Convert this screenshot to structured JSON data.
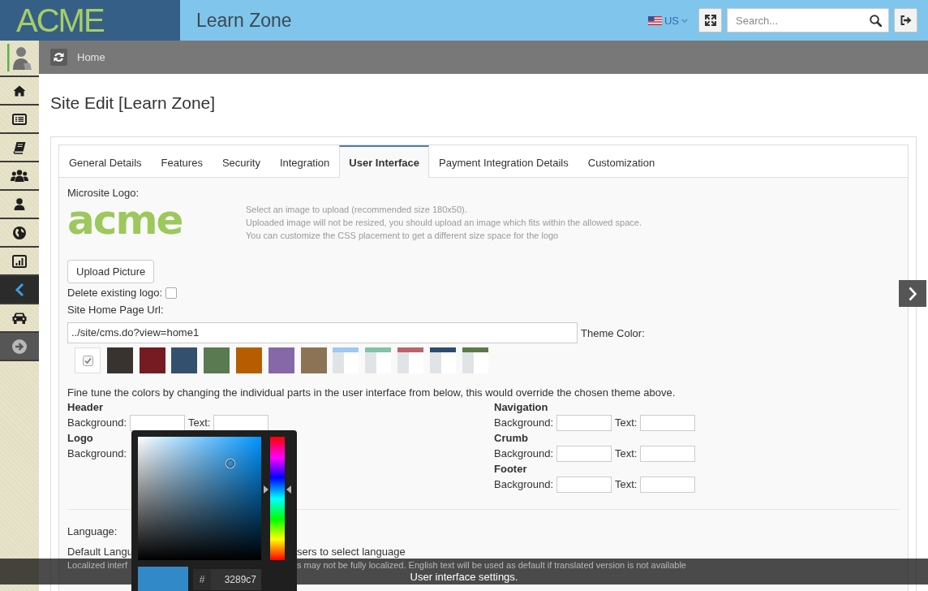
{
  "topbar": {
    "brand": "ACME",
    "site_name": "Learn Zone",
    "language": "US",
    "search": {
      "placeholder": "Search..."
    }
  },
  "sidebar": {
    "items": [
      {
        "kind": "link",
        "selected": false
      },
      {
        "kind": "link",
        "selected": false
      },
      {
        "kind": "link",
        "selected": false
      },
      {
        "kind": "link",
        "selected": false
      },
      {
        "kind": "link",
        "selected": false
      },
      {
        "kind": "link",
        "selected": false
      },
      {
        "kind": "link",
        "selected": false
      },
      {
        "kind": "link",
        "selected": true
      },
      {
        "kind": "link",
        "selected": false
      },
      {
        "kind": "toggle",
        "selected": false
      }
    ]
  },
  "breadcrumb": {
    "items": [
      "Home"
    ]
  },
  "page_title": "Site Edit [Learn Zone]",
  "tabs": [
    {
      "label": "General Details",
      "selected": false
    },
    {
      "label": "Features",
      "selected": false
    },
    {
      "label": "Security",
      "selected": false
    },
    {
      "label": "Integration",
      "selected": false
    },
    {
      "label": "User Interface",
      "selected": true
    },
    {
      "label": "Payment Integration Details",
      "selected": false
    },
    {
      "label": "Customization",
      "selected": false
    }
  ],
  "logo_section": {
    "label": "Microsite Logo:",
    "logo_text": "acme",
    "help_lines": [
      "Select an image to upload (recommended size 180x50).",
      "Uploaded image will not be resized, you should upload an image which fits within the allowed space.",
      "You can customize the CSS placement to get a different size space for the logo"
    ],
    "upload_button": "Upload Picture",
    "delete_label": "Delete existing logo:",
    "delete_checked": false
  },
  "home_url": {
    "label": "Site Home Page Url:",
    "value": "../site/cms.do?view=home1"
  },
  "theme": {
    "label": "Theme Color:",
    "swatches": [
      {
        "kind": "solid",
        "color": "#ffffff",
        "selected": true
      },
      {
        "kind": "solid",
        "color": "#393330",
        "selected": false
      },
      {
        "kind": "solid",
        "color": "#761b21",
        "selected": false
      },
      {
        "kind": "solid",
        "color": "#34506f",
        "selected": false
      },
      {
        "kind": "solid",
        "color": "#5a7a52",
        "selected": false
      },
      {
        "kind": "solid",
        "color": "#b65d00",
        "selected": false
      },
      {
        "kind": "solid",
        "color": "#8668a8",
        "selected": false
      },
      {
        "kind": "solid",
        "color": "#8c7355",
        "selected": false
      },
      {
        "kind": "layout",
        "color": "#9cc9f5",
        "selected": false
      },
      {
        "kind": "layout",
        "color": "#83c3a8",
        "selected": false
      },
      {
        "kind": "layout",
        "color": "#bc636c",
        "selected": false
      },
      {
        "kind": "layout",
        "color": "#2f4b6e",
        "selected": false
      },
      {
        "kind": "layout",
        "color": "#5a7a4c",
        "selected": false
      }
    ]
  },
  "fine_tune": {
    "intro": "Fine tune the colors by changing the individual parts in the user interface from below, this would override the chosen theme above.",
    "columns": [
      {
        "groups": [
          {
            "title": "Header",
            "fields": [
              {
                "label": "Background:",
                "covered": false
              },
              {
                "label": "Text:",
                "covered": false
              }
            ]
          },
          {
            "title": "Logo",
            "fields": [
              {
                "label": "Background:",
                "covered": true
              }
            ]
          }
        ]
      },
      {
        "groups": [
          {
            "title": "Navigation",
            "fields": [
              {
                "label": "Background:",
                "covered": false
              },
              {
                "label": "Text:",
                "covered": false
              }
            ]
          },
          {
            "title": "Crumb",
            "fields": [
              {
                "label": "Background:",
                "covered": false
              },
              {
                "label": "Text:",
                "covered": false
              }
            ]
          },
          {
            "title": "Footer",
            "fields": [
              {
                "label": "Background:",
                "covered": false
              },
              {
                "label": "Text:",
                "covered": false
              }
            ]
          }
        ]
      }
    ]
  },
  "language": {
    "label": "Language:",
    "default_parts": [
      "Default Langu",
      "sers to select language"
    ],
    "note_parts": [
      "Localized interf",
      "s may not be fully localized. English text will be used as default if translated version is not available"
    ]
  },
  "color_picker": {
    "hue_slider": {
      "level": 0.57
    },
    "hash": "#",
    "hex": "3289c7"
  },
  "caption": "User interface settings."
}
